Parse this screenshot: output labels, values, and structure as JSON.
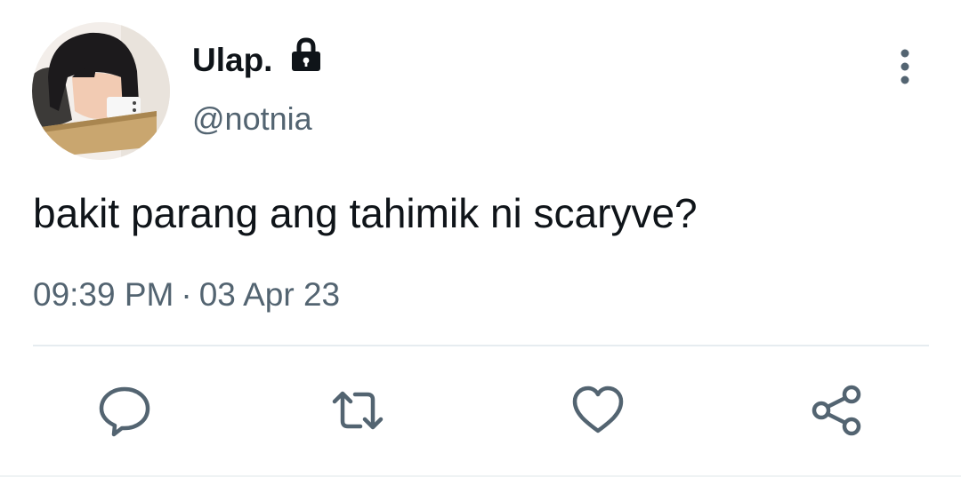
{
  "user": {
    "display_name": "Ulap.",
    "handle": "@notnia",
    "avatar_icon": "profile-photo",
    "protected_icon": "lock-icon"
  },
  "tweet": {
    "text": "bakit parang ang tahimik ni scaryve?",
    "time": "09:39 PM",
    "separator": "·",
    "date": "03 Apr 23"
  },
  "actions": [
    {
      "name": "reply",
      "icon": "speech-bubble-icon"
    },
    {
      "name": "retweet",
      "icon": "retweet-icon"
    },
    {
      "name": "like",
      "icon": "heart-icon"
    },
    {
      "name": "share",
      "icon": "share-icon"
    }
  ],
  "menu": {
    "icon": "more-vertical-icon"
  },
  "colors": {
    "text_primary": "#0f1419",
    "text_secondary": "#536471",
    "divider": "#e6ecf0",
    "icon": "#536471"
  }
}
